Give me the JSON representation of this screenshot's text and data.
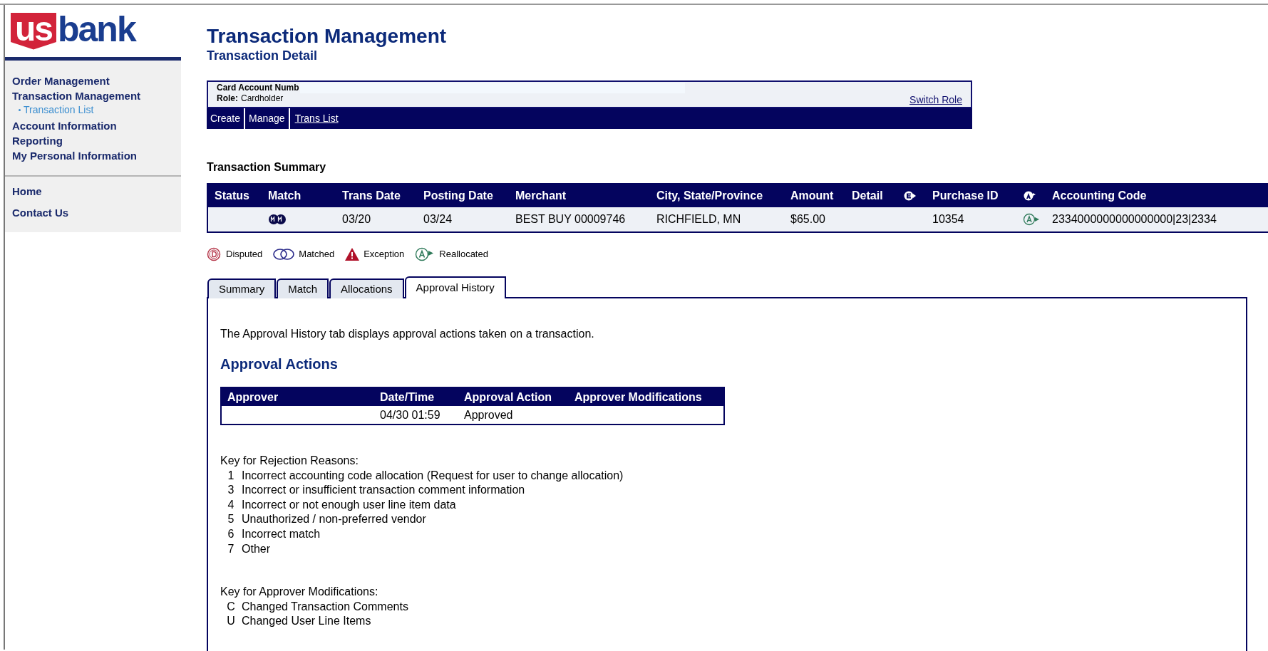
{
  "logo": {
    "left": "us",
    "right": "bank"
  },
  "sidebar": {
    "items": [
      {
        "label": "Order Management"
      },
      {
        "label": "Transaction Management",
        "children": [
          {
            "label": "Transaction List"
          }
        ]
      },
      {
        "label": "Account Information"
      },
      {
        "label": "Reporting"
      },
      {
        "label": "My Personal Information"
      }
    ],
    "footer_items": [
      {
        "label": "Home"
      },
      {
        "label": "Contact Us"
      }
    ]
  },
  "header": {
    "title": "Transaction Management",
    "subtitle": "Transaction Detail"
  },
  "account": {
    "card_label": "Card Account Numb",
    "role_label": "Role:",
    "role": "Cardholder",
    "switch_role": "Switch Role"
  },
  "nav": [
    {
      "label": "Create",
      "kind": "plain"
    },
    {
      "label": "Manage",
      "kind": "plain"
    },
    {
      "label": "Trans List",
      "kind": "link"
    }
  ],
  "summary": {
    "title": "Transaction Summary",
    "columns": [
      {
        "kind": "text",
        "label": "Status"
      },
      {
        "kind": "text",
        "label": "Match"
      },
      {
        "kind": "text",
        "label": "Trans Date"
      },
      {
        "kind": "text",
        "label": "Posting Date"
      },
      {
        "kind": "text",
        "label": "Merchant"
      },
      {
        "kind": "text",
        "label": "City, State/Province"
      },
      {
        "kind": "text",
        "label": "Amount"
      },
      {
        "kind": "text",
        "label": "Detail"
      },
      {
        "kind": "e_icon"
      },
      {
        "kind": "text",
        "label": "Purchase ID"
      },
      {
        "kind": "a_icon"
      },
      {
        "kind": "text",
        "label": "Accounting Code"
      }
    ],
    "rows": [
      [
        {
          "kind": "blank"
        },
        {
          "kind": "matched_icon"
        },
        {
          "kind": "text",
          "text": "03/20"
        },
        {
          "kind": "text",
          "text": "03/24"
        },
        {
          "kind": "text",
          "text": "BEST BUY 00009746"
        },
        {
          "kind": "text",
          "text": "RICHFIELD, MN"
        },
        {
          "kind": "text",
          "text": "$65.00"
        },
        {
          "kind": "blank"
        },
        {
          "kind": "blank"
        },
        {
          "kind": "text",
          "text": "10354"
        },
        {
          "kind": "reallocated_icon"
        },
        {
          "kind": "text",
          "text": "2334000000000000000|23|2334"
        }
      ]
    ]
  },
  "legend": [
    {
      "kind": "disputed",
      "label": "Disputed"
    },
    {
      "kind": "matched",
      "label": "Matched"
    },
    {
      "kind": "exception",
      "label": "Exception"
    },
    {
      "kind": "reallocated",
      "label": "Reallocated"
    }
  ],
  "tabs": [
    {
      "label": "Summary",
      "selected": false
    },
    {
      "label": "Match",
      "selected": false
    },
    {
      "label": "Allocations",
      "selected": false
    },
    {
      "label": "Approval History",
      "selected": true
    }
  ],
  "panel": {
    "intro": "The Approval History tab displays approval actions taken on a transaction.",
    "section_title": "Approval Actions",
    "approvals": {
      "columns": [
        "Approver",
        "Date/Time",
        "Approval Action",
        "Approver Modifications"
      ],
      "rows": [
        [
          "",
          "04/30 01:59",
          "Approved"
        ]
      ]
    },
    "rejection_key": {
      "title": "Key for Rejection Reasons:",
      "items": [
        {
          "code": "1",
          "text": "Incorrect accounting code allocation (Request for user to change allocation)"
        },
        {
          "code": "3",
          "text": "Incorrect or insufficient transaction comment information"
        },
        {
          "code": "4",
          "text": "Incorrect or not enough user line item data"
        },
        {
          "code": "5",
          "text": "Unauthorized / non-preferred vendor"
        },
        {
          "code": "6",
          "text": "Incorrect match"
        },
        {
          "code": "7",
          "text": "Other"
        }
      ]
    },
    "modification_key": {
      "title": "Key for Approver Modifications:",
      "items": [
        {
          "code": "C",
          "text": "Changed Transaction Comments"
        },
        {
          "code": "U",
          "text": "Changed User Line Items"
        }
      ]
    }
  }
}
